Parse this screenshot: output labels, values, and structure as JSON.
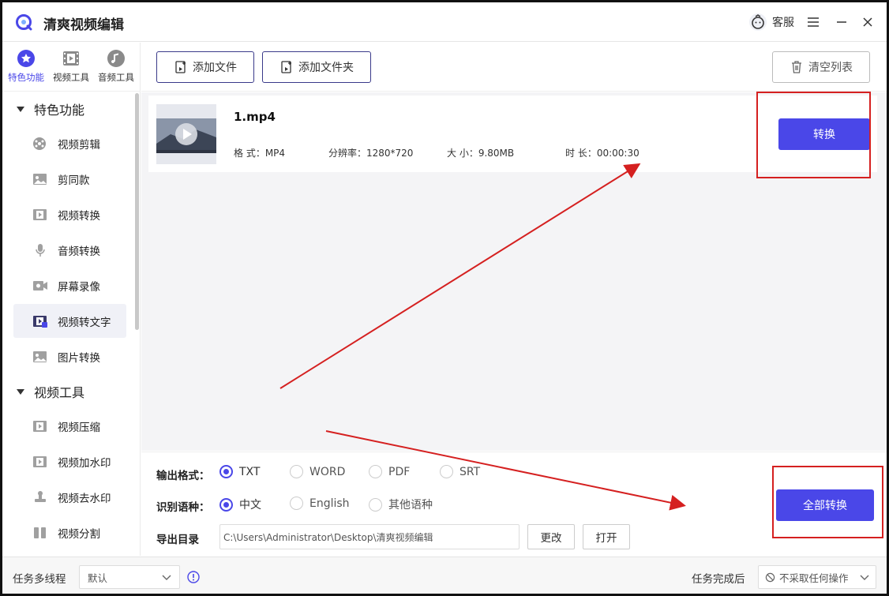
{
  "app": {
    "title": "清爽视频编辑",
    "support": "客服"
  },
  "topnav": [
    {
      "label": "特色功能"
    },
    {
      "label": "视频工具"
    },
    {
      "label": "音频工具"
    }
  ],
  "sidebar": {
    "section1": "特色功能",
    "items1": [
      {
        "label": "视频剪辑"
      },
      {
        "label": "剪同款"
      },
      {
        "label": "视频转换"
      },
      {
        "label": "音频转换"
      },
      {
        "label": "屏幕录像"
      },
      {
        "label": "视频转文字"
      },
      {
        "label": "图片转换"
      }
    ],
    "section2": "视频工具",
    "items2": [
      {
        "label": "视频压缩"
      },
      {
        "label": "视频加水印"
      },
      {
        "label": "视频去水印"
      },
      {
        "label": "视频分割"
      }
    ]
  },
  "toolbar": {
    "add_file": "添加文件",
    "add_folder": "添加文件夹",
    "clear_list": "清空列表"
  },
  "file": {
    "name": "1.mp4",
    "format": "格 式：MP4",
    "resolution": "分辨率：1280*720",
    "size": "大 小：9.80MB",
    "duration": "时 长：00:00:30",
    "convert": "转换"
  },
  "settings": {
    "output_label": "输出格式：",
    "formats": [
      {
        "label": "TXT",
        "selected": true
      },
      {
        "label": "WORD",
        "selected": false
      },
      {
        "label": "PDF",
        "selected": false
      },
      {
        "label": "SRT",
        "selected": false
      }
    ],
    "lang_label": "识别语种：",
    "langs": [
      {
        "label": "中文",
        "selected": true
      },
      {
        "label": "English",
        "selected": false
      },
      {
        "label": "其他语种",
        "selected": false
      }
    ],
    "export_label": "导出目录",
    "export_path": "C:\\Users\\Administrator\\Desktop\\清爽视频编辑",
    "change": "更改",
    "open": "打开",
    "convert_all": "全部转换"
  },
  "status": {
    "threads_label": "任务多线程",
    "threads_value": "默认",
    "after_label": "任务完成后",
    "after_value": "不采取任何操作"
  },
  "colors": {
    "accent": "#4a47e8",
    "annotation": "#d52020"
  }
}
